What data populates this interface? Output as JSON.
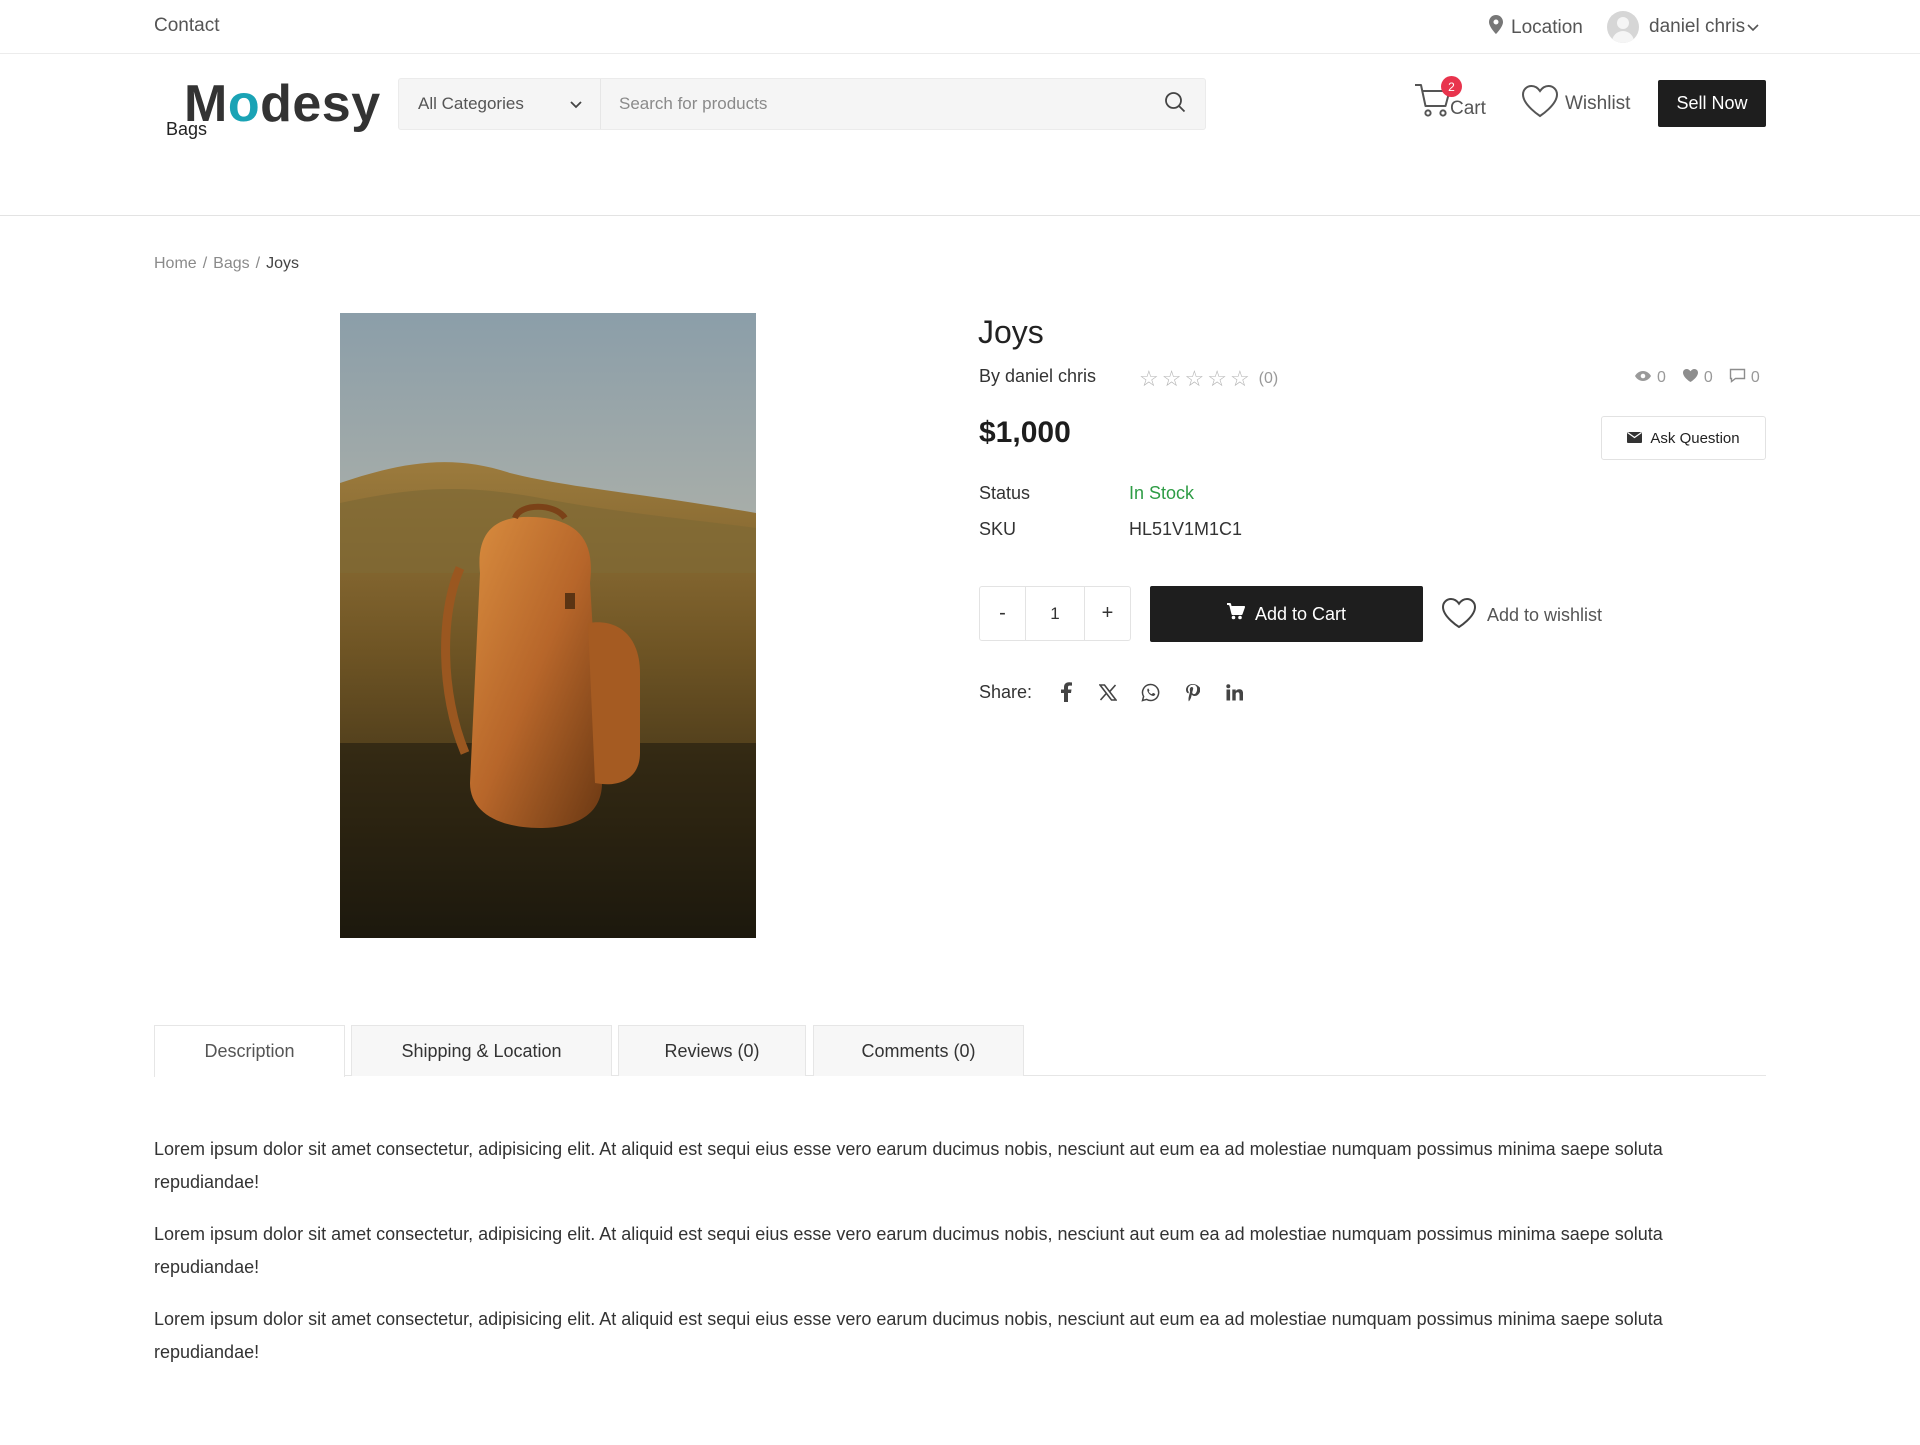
{
  "topbar": {
    "contact": "Contact",
    "location": "Location",
    "username": "daniel chris"
  },
  "header": {
    "logo_pre": "M",
    "logo_o": "o",
    "logo_post": "desy",
    "category": "All Categories",
    "search_placeholder": "Search for products",
    "cart_label": "Cart",
    "cart_count": "2",
    "wishlist_label": "Wishlist",
    "sell_label": "Sell Now"
  },
  "nav": {
    "items": [
      "Bags"
    ]
  },
  "breadcrumb": {
    "home": "Home",
    "sep": "/",
    "category": "Bags",
    "current": "Joys"
  },
  "product": {
    "title": "Joys",
    "byline": "By daniel chris",
    "rating_count": "(0)",
    "views": "0",
    "likes": "0",
    "comments": "0",
    "price": "$1,000",
    "ask_question": "Ask Question",
    "status_label": "Status",
    "status_value": "In Stock",
    "sku_label": "SKU",
    "sku_value": "HL51V1M1C1",
    "qty_minus": "-",
    "qty_value": "1",
    "qty_plus": "+",
    "add_to_cart": "Add to Cart",
    "add_to_wishlist": "Add to wishlist",
    "share_label": "Share:",
    "share_icons": [
      "facebook-icon",
      "x-icon",
      "whatsapp-icon",
      "pinterest-icon",
      "linkedin-icon"
    ]
  },
  "tabs": [
    {
      "label": "Description",
      "active": true
    },
    {
      "label": "Shipping & Location",
      "active": false
    },
    {
      "label": "Reviews (0)",
      "active": false
    },
    {
      "label": "Comments (0)",
      "active": false
    }
  ],
  "description": {
    "paragraphs": [
      "Lorem ipsum dolor sit amet consectetur, adipisicing elit. At aliquid est sequi eius esse vero earum ducimus nobis, nesciunt aut eum ea ad molestiae numquam possimus minima saepe soluta repudiandae!",
      "Lorem ipsum dolor sit amet consectetur, adipisicing elit. At aliquid est sequi eius esse vero earum ducimus nobis, nesciunt aut eum ea ad molestiae numquam possimus minima saepe soluta repudiandae!",
      "Lorem ipsum dolor sit amet consectetur, adipisicing elit. At aliquid est sequi eius esse vero earum ducimus nobis, nesciunt aut eum ea ad molestiae numquam possimus minima saepe soluta repudiandae!"
    ]
  },
  "colors": {
    "accent": "#1aa3b5",
    "dark_button": "#1e1e1e",
    "in_stock": "#2e9c45",
    "badge": "#e8344d"
  }
}
